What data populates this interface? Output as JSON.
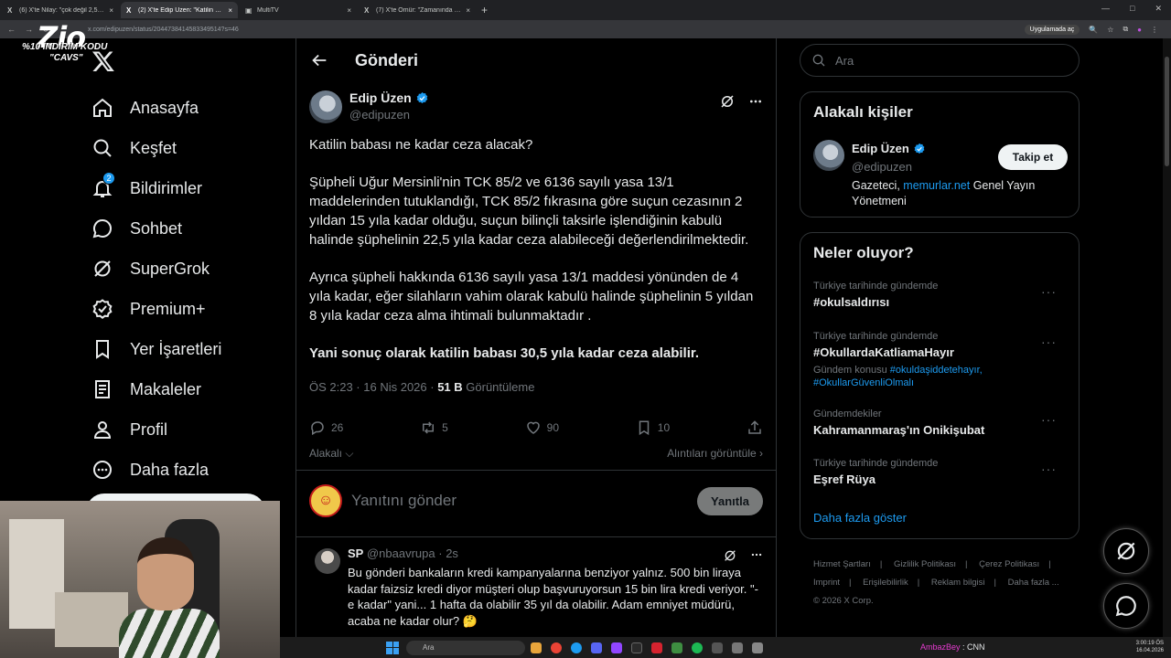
{
  "browser": {
    "tabs": [
      {
        "label": "(6) X'te Nilay: \"çok değil 2,5 se",
        "active": false
      },
      {
        "label": "(2) X'te Edip Üzen: \"Katilin baba",
        "active": true
      },
      {
        "label": "MultiTV",
        "active": false
      },
      {
        "label": "(7) X'te Ömür: \"Zamanında ken",
        "active": false
      }
    ],
    "url": "x.com/edipuzen/status/2044738414583349514?s=46",
    "app_link": "Uygulamada aç"
  },
  "promo": {
    "logo": "Zio",
    "line1": "%10 İNDİRİM KODU",
    "line2": "\"CAVS\""
  },
  "nav": {
    "items": [
      {
        "label": "Anasayfa",
        "icon": "home-icon"
      },
      {
        "label": "Keşfet",
        "icon": "search-icon"
      },
      {
        "label": "Bildirimler",
        "icon": "bell-icon",
        "badge": "2"
      },
      {
        "label": "Sohbet",
        "icon": "chat-icon"
      },
      {
        "label": "SuperGrok",
        "icon": "grok-icon"
      },
      {
        "label": "Premium+",
        "icon": "premium-icon"
      },
      {
        "label": "Yer İşaretleri",
        "icon": "bookmark-icon"
      },
      {
        "label": "Makaleler",
        "icon": "article-icon"
      },
      {
        "label": "Profil",
        "icon": "profile-icon"
      },
      {
        "label": "Daha fazla",
        "icon": "more-circle-icon"
      }
    ]
  },
  "post": {
    "header_title": "Gönderi",
    "author_name": "Edip Üzen",
    "author_handle": "@edipuzen",
    "paragraphs": [
      "Katilin babası ne kadar ceza alacak?",
      "Şüpheli Uğur Mersinli'nin TCK 85/2 ve 6136 sayılı yasa 13/1 maddelerinden tutuklandığı, TCK 85/2 fıkrasına göre suçun cezasının 2 yıldan 15 yıla kadar olduğu, suçun bilinçli taksirle işlendiğinin kabulü halinde şüphelinin 22,5 yıla kadar ceza alabileceği değerlendirilmektedir.",
      "Ayrıca şüpheli hakkında 6136 sayılı yasa 13/1 maddesi yönünden de 4 yıla kadar, eğer silahların vahim olarak kabulü halinde şüphelinin 5 yıldan 8 yıla kadar ceza alma ihtimali bulunmaktadır .",
      "Yani sonuç olarak katilin babası 30,5 yıla kadar ceza alabilir."
    ],
    "time": "ÖS 2:23 · 16 Nis 2026 · ",
    "views": "51 B",
    "views_label": " Görüntüleme",
    "replies": "26",
    "reposts": "5",
    "likes": "90",
    "bookmarks": "10",
    "relevance": "Alakalı",
    "quotes": "Alıntıları görüntüle",
    "reply_placeholder": "Yanıtını gönder",
    "reply_button": "Yanıtla"
  },
  "reply": {
    "name": "SP",
    "handle": "@nbaavrupa",
    "time": "2s",
    "text": "Bu gönderi bankaların kredi kampanyalarına benziyor yalnız. 500 bin liraya kadar faizsiz kredi diyor müşteri olup başvuruyorsun 15 bin lira kredi veriyor. \"-e kadar\" yani... 1 hafta da olabilir 35 yıl da olabilir. Adam emniyet müdürü, acaba ne kadar olur? 🤔"
  },
  "sidebar": {
    "search_placeholder": "Ara",
    "related_title": "Alakalı kişiler",
    "related_name": "Edip Üzen",
    "related_handle": "@edipuzen",
    "follow": "Takip et",
    "bio_pre": "Gazeteci, ",
    "bio_link": "memurlar.net",
    "bio_post": " Genel Yayın Yönetmeni",
    "trends_title": "Neler oluyor?",
    "trends": [
      {
        "context": "Türkiye tarihinde gündemde",
        "name": "#okulsaldırısı"
      },
      {
        "context": "Türkiye tarihinde gündemde",
        "name": "#OkullardaKatliamaHayır",
        "sub_pre": "Gündem konusu ",
        "sub_tags": "#okuldaşiddetehayır, #OkullarGüvenliOlmalı"
      },
      {
        "context": "Gündemdekiler",
        "name": "Kahramanmaraş'ın Onikişubat"
      },
      {
        "context": "Türkiye tarihinde gündemde",
        "name": "Eşref Rüya"
      }
    ],
    "show_more": "Daha fazla göster",
    "footer": [
      "Hizmet Şartları",
      "Gizlilik Politikası",
      "Çerez Politikası",
      "Imprint",
      "Erişilebilirlik",
      "Reklam bilgisi",
      "Daha fazla ...",
      "© 2026 X Corp."
    ]
  },
  "taskbar": {
    "search": "Ara",
    "stream_name": "AmbazBey",
    "stream_suffix": " : CNN",
    "time": "3:00:19 ÖS",
    "date": "16.04.2026"
  },
  "colors": {
    "accent": "#1d9bf0",
    "background": "#000000",
    "border": "#2f3336",
    "muted": "#71767b"
  }
}
